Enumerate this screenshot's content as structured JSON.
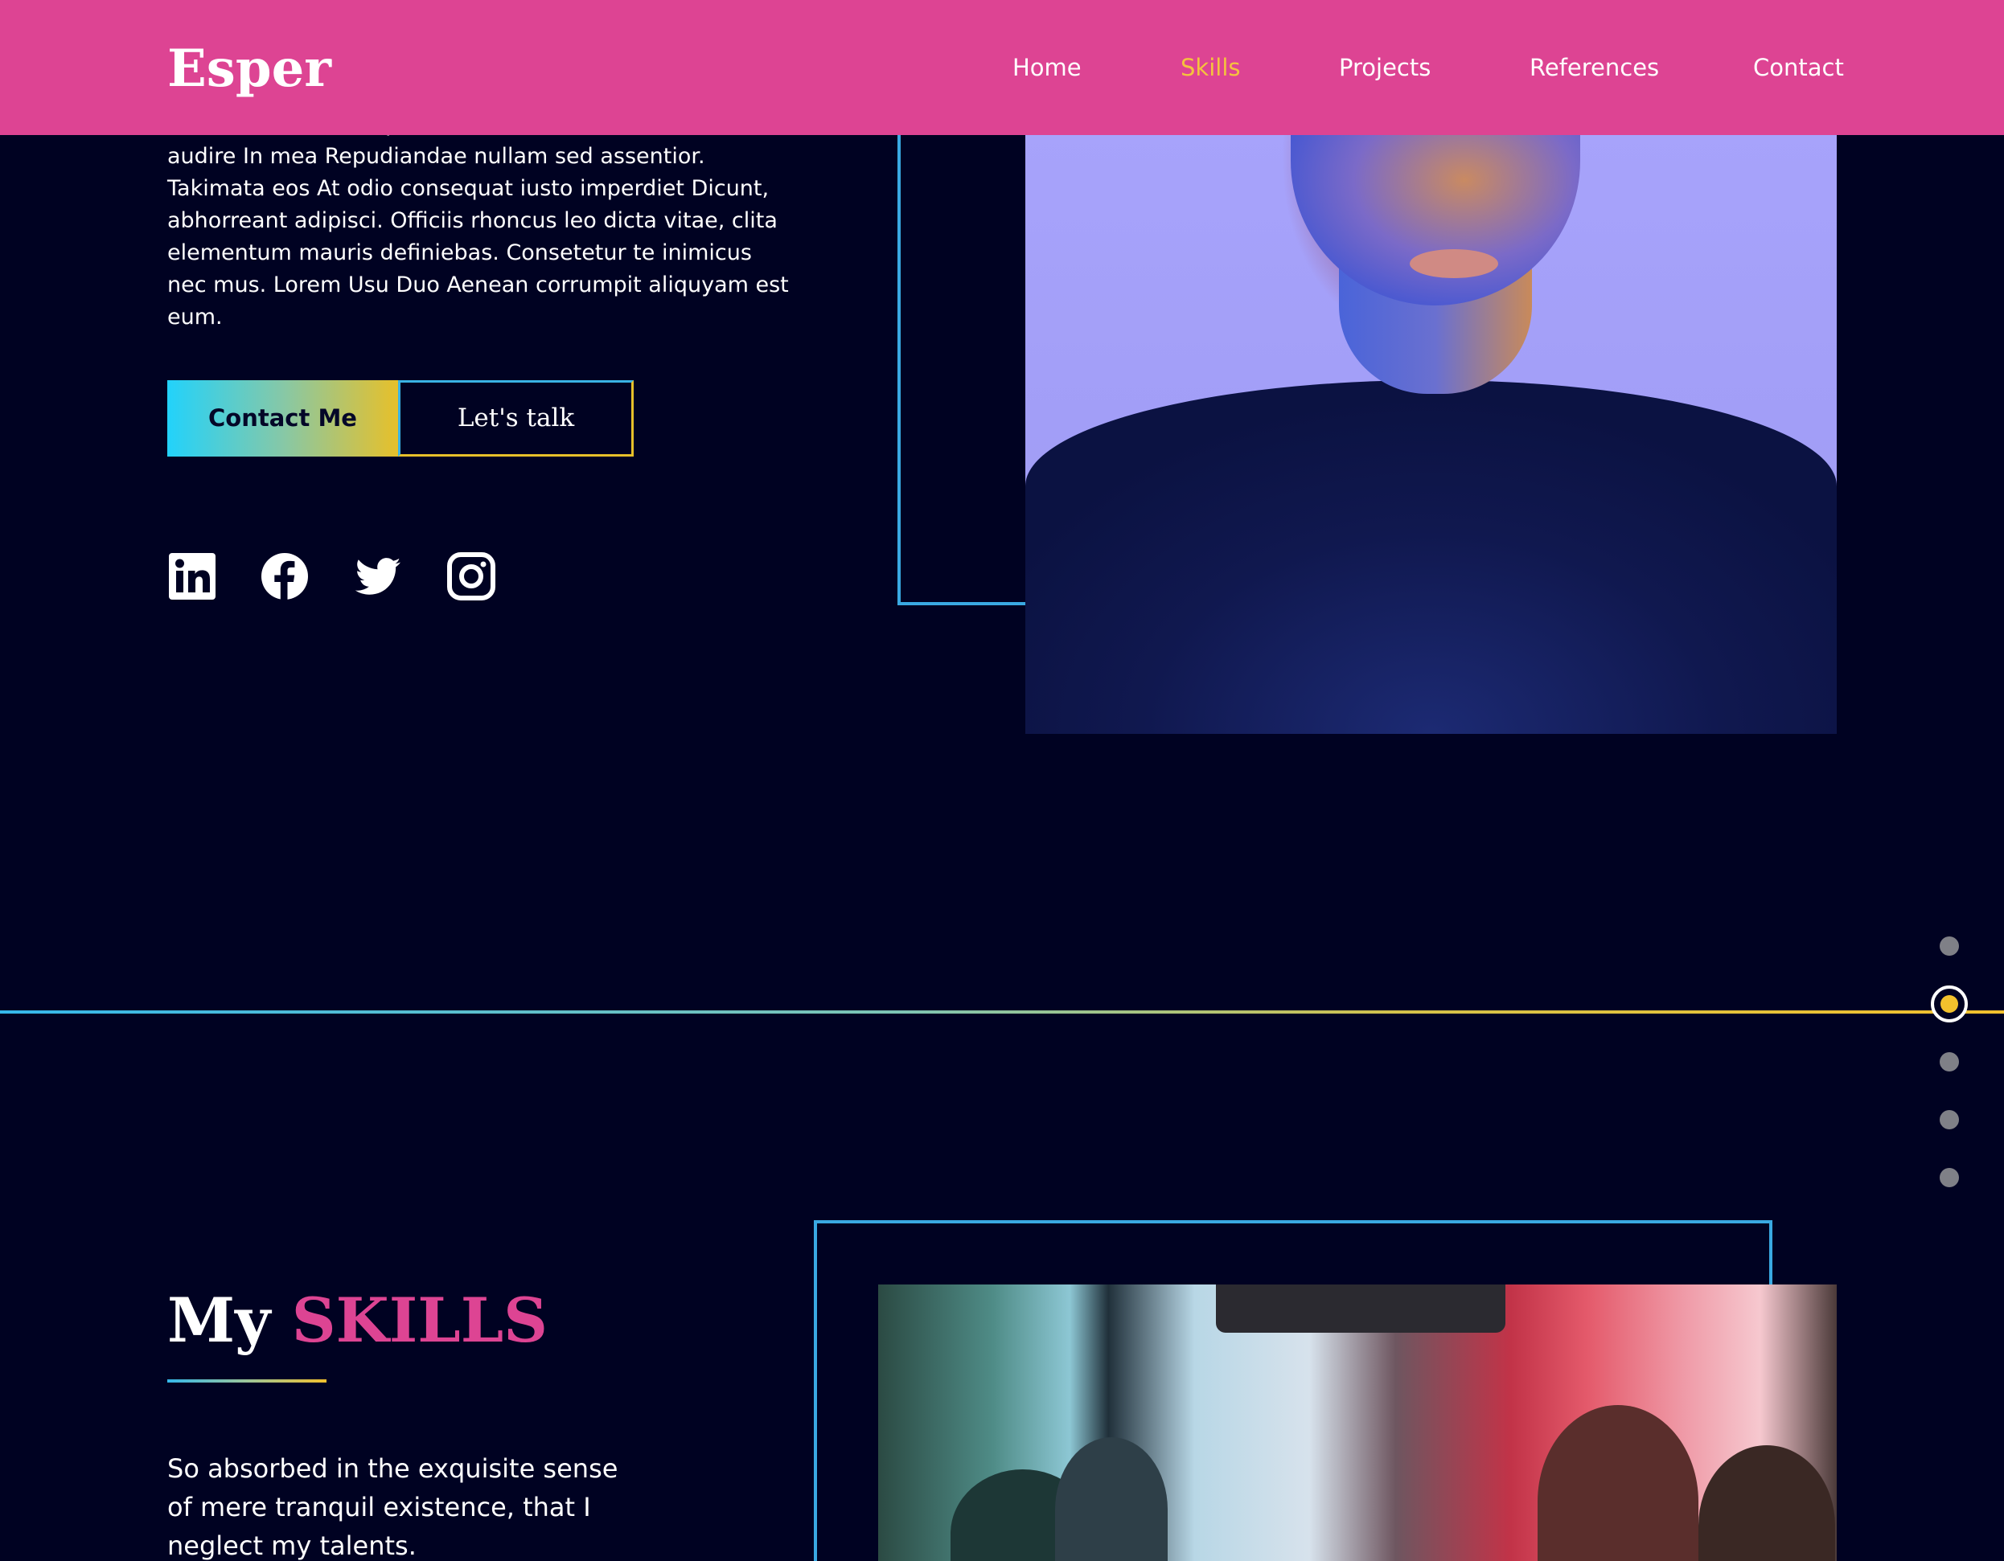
{
  "header": {
    "logo": "Esper",
    "nav": [
      {
        "label": "Home",
        "active": false
      },
      {
        "label": "Skills",
        "active": true
      },
      {
        "label": "Projects",
        "active": false
      },
      {
        "label": "References",
        "active": false
      },
      {
        "label": "Contact",
        "active": false
      }
    ],
    "background_color": "#dd4493",
    "active_color": "#f5c23e"
  },
  "hero": {
    "paragraph": "labore inimicus voluptua. Penatibus sea Vel amet. His ius audire In mea Repudiandae nullam sed assentior. Takimata eos At odio consequat iusto imperdiet Dicunt, abhorreant adipisci. Officiis rhoncus leo dicta vitae, clita elementum mauris definiebas. Consetetur te inimicus nec mus. Lorem Usu Duo Aenean corrumpit aliquyam est eum.",
    "contact_button": "Contact Me",
    "talk_button": "Let's talk",
    "social_icons": [
      "linkedin-icon",
      "facebook-icon",
      "twitter-icon",
      "instagram-icon"
    ]
  },
  "section_dots": {
    "count": 5,
    "active_index": 2,
    "active_color": "#f2c12d",
    "inactive_color": "#7f8087"
  },
  "skills": {
    "title_prefix": "My",
    "title_accent": "SKILLS",
    "accent_color": "#dd4493",
    "paragraph": "So absorbed in the exquisite sense of mere tranquil existence, that I neglect my talents."
  },
  "theme": {
    "page_background": "#000222",
    "frame_color": "#3aa9e2"
  }
}
